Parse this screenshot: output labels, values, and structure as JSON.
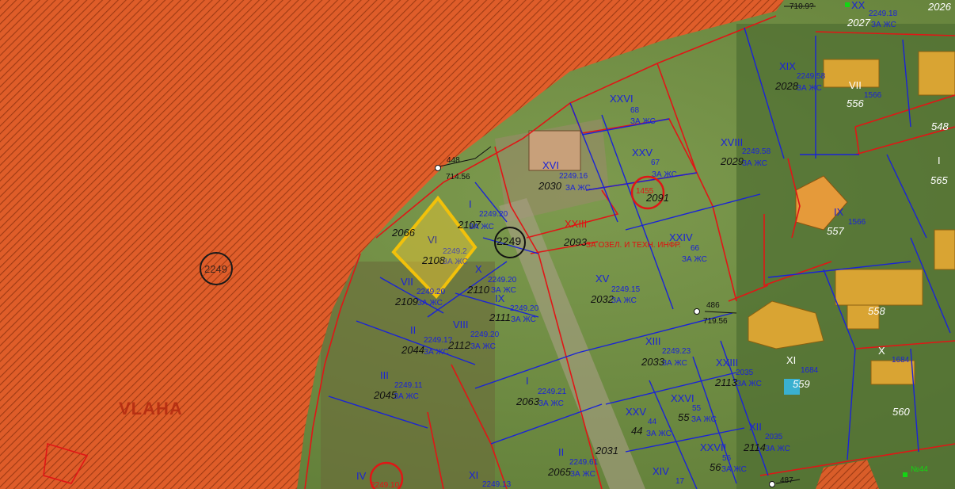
{
  "map": {
    "highlighted_plot": {
      "id": "2108",
      "roman": "VI",
      "cad": "2249.2",
      "use": "ЗА ЖС"
    },
    "points": [
      {
        "id": "448",
        "elev": "714.56"
      },
      {
        "id": "486",
        "elev": "719.56"
      },
      {
        "id": "487",
        "elev": ""
      },
      {
        "id": "",
        "elev": "710.9?"
      }
    ],
    "circled_labels": [
      "2249",
      "1455",
      "2249.10",
      "2249"
    ],
    "red_text": [
      "XXIII",
      "ЗА ОЗЕЛ. И ТЕХН. ИНФР.",
      "VLAHA"
    ],
    "plots": [
      {
        "roman": "I",
        "num": "2107",
        "cad": "2249.20",
        "use": "ЗА ЖС"
      },
      {
        "roman": "VI",
        "num": "2108",
        "cad": "2249.2",
        "use": "ЗА ЖС"
      },
      {
        "roman": "X",
        "num": "2110",
        "cad": "2249.20",
        "use": "ЗА ЖС"
      },
      {
        "roman": "VII",
        "num": "2109",
        "cad": "2249.20",
        "use": "ЗА ЖС"
      },
      {
        "roman": "IX",
        "num": "2111",
        "cad": "2249.20",
        "use": "ЗА ЖС"
      },
      {
        "roman": "VIII",
        "num": "2112",
        "cad": "2249.20",
        "use": "ЗА ЖС"
      },
      {
        "roman": "II",
        "num": "2044",
        "cad": "2249.1?",
        "use": "ЗА ЖС"
      },
      {
        "roman": "III",
        "num": "2045",
        "cad": "2249.11",
        "use": "ЗА ЖС"
      },
      {
        "roman": "XVI",
        "num": "2030",
        "cad": "2249.16",
        "use": "ЗА ЖС"
      },
      {
        "roman": "XXVI",
        "num": "68",
        "cad": "",
        "use": "ЗА ЖС"
      },
      {
        "roman": "XXV",
        "num": "67",
        "cad": "",
        "use": "ЗА ЖС"
      },
      {
        "roman": "XXIV",
        "num": "66",
        "cad": "",
        "use": "ЗА ЖС"
      },
      {
        "roman": "XV",
        "num": "2032",
        "cad": "2249.15",
        "use": "ЗА ЖС"
      },
      {
        "roman": "XIII",
        "num": "2033",
        "cad": "2249.23",
        "use": "ЗА ЖС"
      },
      {
        "roman": "XXIII",
        "num": "2113",
        "cad": "2035",
        "use": "ЗА ЖС"
      },
      {
        "roman": "I",
        "num": "2063",
        "cad": "2249.21",
        "use": "ЗА ЖС"
      },
      {
        "roman": "XXV",
        "num": "44",
        "cad": "44",
        "use": "ЗА ЖС"
      },
      {
        "roman": "XXVI",
        "num": "55",
        "cad": "55",
        "use": "ЗА ЖС"
      },
      {
        "roman": "XXVII",
        "num": "56",
        "cad": "56",
        "use": "ЗА ЖС"
      },
      {
        "roman": "XII",
        "num": "2114",
        "cad": "2035",
        "use": "ЗА ЖС"
      },
      {
        "roman": "II",
        "num": "2065",
        "cad": "2249.61",
        "use": "ЗА ЖС"
      },
      {
        "roman": "XI",
        "num": "",
        "cad": "2249.13",
        "use": ""
      },
      {
        "roman": "XIV",
        "num": "",
        "cad": "17",
        "use": ""
      },
      {
        "roman": "IV",
        "num": "",
        "cad": "",
        "use": ""
      },
      {
        "roman": "XVIII",
        "num": "2029",
        "cad": "2249.58",
        "use": "ЗА ЖС"
      },
      {
        "roman": "XIX",
        "num": "2028",
        "cad": "2249.58",
        "use": "ЗА ЖС"
      },
      {
        "roman": "VII",
        "num": "556",
        "cad": "1566",
        "use": ""
      },
      {
        "roman": "IX",
        "num": "557",
        "cad": "1566",
        "use": ""
      },
      {
        "roman": "XI",
        "num": "559",
        "cad": "1684",
        "use": ""
      },
      {
        "roman": "X",
        "num": "",
        "cad": "1684",
        "use": ""
      },
      {
        "roman": "XX",
        "num": "2027",
        "cad": "2249.18",
        "use": "ЗА ЖС"
      },
      {
        "roman": "I",
        "num": "565",
        "cad": "",
        "use": ""
      }
    ],
    "other_numbers": [
      "2066",
      "2091",
      "2093",
      "2031",
      "548",
      "558",
      "560",
      "2026",
      "№44"
    ]
  }
}
